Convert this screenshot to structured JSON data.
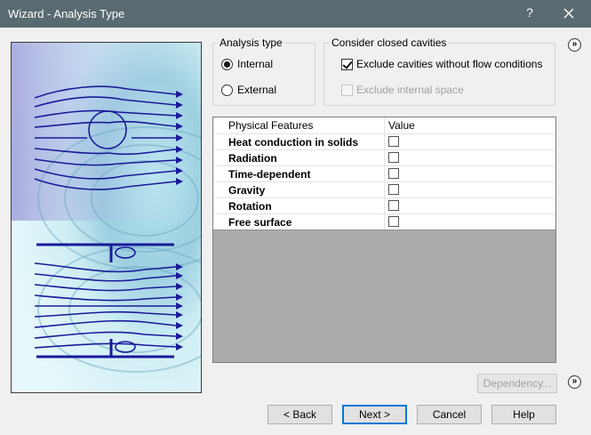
{
  "window": {
    "title": "Wizard - Analysis Type",
    "help_label": "?"
  },
  "analysis_type": {
    "label": "Analysis type",
    "options": [
      {
        "label": "Internal",
        "selected": true
      },
      {
        "label": "External",
        "selected": false
      }
    ]
  },
  "cavities": {
    "label": "Consider closed cavities",
    "exclude_no_flow": {
      "label": "Exclude cavities without flow conditions",
      "checked": true,
      "enabled": true
    },
    "exclude_internal": {
      "label": "Exclude internal space",
      "checked": false,
      "enabled": false
    }
  },
  "features_table": {
    "columns": [
      "Physical Features",
      "Value"
    ],
    "rows": [
      {
        "name": "Heat conduction in solids",
        "checked": false
      },
      {
        "name": "Radiation",
        "checked": false
      },
      {
        "name": "Time-dependent",
        "checked": false
      },
      {
        "name": "Gravity",
        "checked": false
      },
      {
        "name": "Rotation",
        "checked": false
      },
      {
        "name": "Free surface",
        "checked": false
      }
    ]
  },
  "buttons": {
    "dependency": "Dependency...",
    "back": "< Back",
    "next": "Next >",
    "cancel": "Cancel",
    "help": "Help"
  },
  "side_buttons": {
    "top": "»",
    "bottom": "»"
  },
  "colors": {
    "titlebar": "#5a6a71",
    "flow_lines": "#1a1a9a",
    "accent": "#0078d7"
  }
}
